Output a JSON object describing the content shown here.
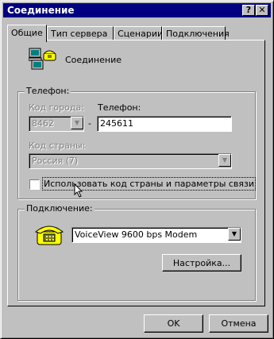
{
  "window": {
    "title": "Соединение",
    "help_label": "?",
    "close_label": "✕"
  },
  "tabs": [
    {
      "label": "Общие",
      "active": true
    },
    {
      "label": "Тип сервера"
    },
    {
      "label": "Сценарии"
    },
    {
      "label": "Подключения"
    }
  ],
  "connection": {
    "name": "Соединение"
  },
  "phone_group": {
    "legend": "Телефон:",
    "city_code_label": "Код города:",
    "city_code_value": "8462",
    "dash": "-",
    "phone_label": "Телефон:",
    "phone_value": "245611",
    "country_code_label": "Код страны:",
    "country_code_value": "Россия (7)",
    "use_country_label": "Использовать код страны и параметры связи"
  },
  "connect_group": {
    "legend": "Подключение:",
    "modem_value": "VoiceView  9600 bps Modem",
    "configure_label": "Настройка..."
  },
  "footer": {
    "ok_label": "OK",
    "cancel_label": "Отмена"
  },
  "icons": {
    "dropdown": "▼",
    "connection": "dialup-computers-icon",
    "modem": "phone-modem-icon"
  },
  "colors": {
    "titlebar": "#000080",
    "face": "#c0c0c0"
  }
}
